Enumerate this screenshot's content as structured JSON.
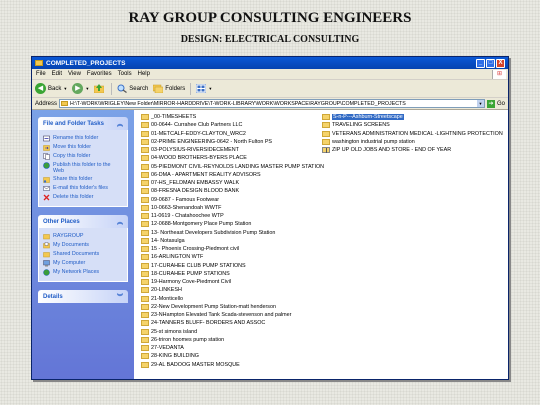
{
  "page": {
    "title": "RAY GROUP CONSULTING ENGINEERS",
    "subtitle": "DESIGN: ELECTRICAL CONSULTING"
  },
  "window": {
    "title": "COMPLETED_PROJECTS",
    "controls": [
      "_",
      "□",
      "X"
    ]
  },
  "menu": [
    "File",
    "Edit",
    "View",
    "Favorites",
    "Tools",
    "Help"
  ],
  "toolbar": {
    "back": "Back",
    "search": "Search",
    "folders": "Folders"
  },
  "address": {
    "label": "Address",
    "value": "H:\\T-WORK\\WRIGLEY\\New Folder\\MIRROR-HARDDRIVE\\T-WORK-LIBRARY\\WORK\\WORKSPACE\\RAYGROUP\\COMPLETED_PROJECTS",
    "go": "Go"
  },
  "tasks": {
    "file_folder": {
      "title": "File and Folder Tasks",
      "items": [
        "Rename this folder",
        "Move this folder",
        "Copy this folder",
        "Publish this folder to the Web",
        "Share this folder",
        "E-mail this folder's files",
        "Delete this folder"
      ]
    },
    "other_places": {
      "title": "Other Places",
      "items": [
        "RAYGROUP",
        "My Documents",
        "Shared Documents",
        "My Computer",
        "My Network Places"
      ]
    },
    "details": {
      "title": "Details"
    }
  },
  "files": {
    "col1": [
      "_00-TIMESHEETS",
      "00-0644- Currahee Club Partners LLC",
      "01-METCALF-EDDY-CLAYTON_WRC2",
      "02-PRIME ENGINEERING-0642 - North Fulton PS",
      "03-POLYSIUS-RIVERSIDECEMENT",
      "04-WOOD BROTHERS-BYERS PLACE",
      "05-PIEDMONT CIVIL-REYNOLDS LANDING MASTER PUMP STATION",
      "06-DMA - APARTMENT REALITY ADVISORS",
      "07-HS_FELDMAN EMBASSY WALK",
      "08-FRESNA DESIGN BLOOD BANK",
      "09-0687 - Famous Footwear",
      "10-0663-Shenandoah WWTF",
      "11-0619 - Chatahoochee WTP",
      "12-0688-Montgomery Place Pump Station",
      "13- Northeast Developers Subdivision Pump Station",
      "14- Notasulga",
      "15 - Phoenix Crossing-Piedmont civil",
      "16-ARLINGTON WTF",
      "17-CURAHEE CLUB PUMP STATIONS",
      "18-CURAHEE PUMP STATIONS",
      "19-Harmony Cove-Piedmont Civil",
      "20-LINKESH",
      "21-Monticello",
      "22-New Development Pump Station-matt henderson",
      "23-NHampton Elevated Tank Scada-stevenson and palmer",
      "24-TANNERS BLUFF- BORDERS AND ASSOC",
      "25-st simons island",
      "26-triron hoomes pump station",
      "27-VEDANTA",
      "28-KING BUILDING",
      "29-AL BADOOG MASTER MOSQUE"
    ],
    "col2": [
      "S-n-P---Ashburn-Streetscape",
      "TRAVELING SCREENS",
      "VETERANS ADMINISTRATION MEDICAL -LIGHTNING PROTECTION",
      "washington industrial pump station",
      "ZIP UP OLD JOBS AND STORE - END OF YEAR"
    ],
    "selected_index_col2": 0
  }
}
